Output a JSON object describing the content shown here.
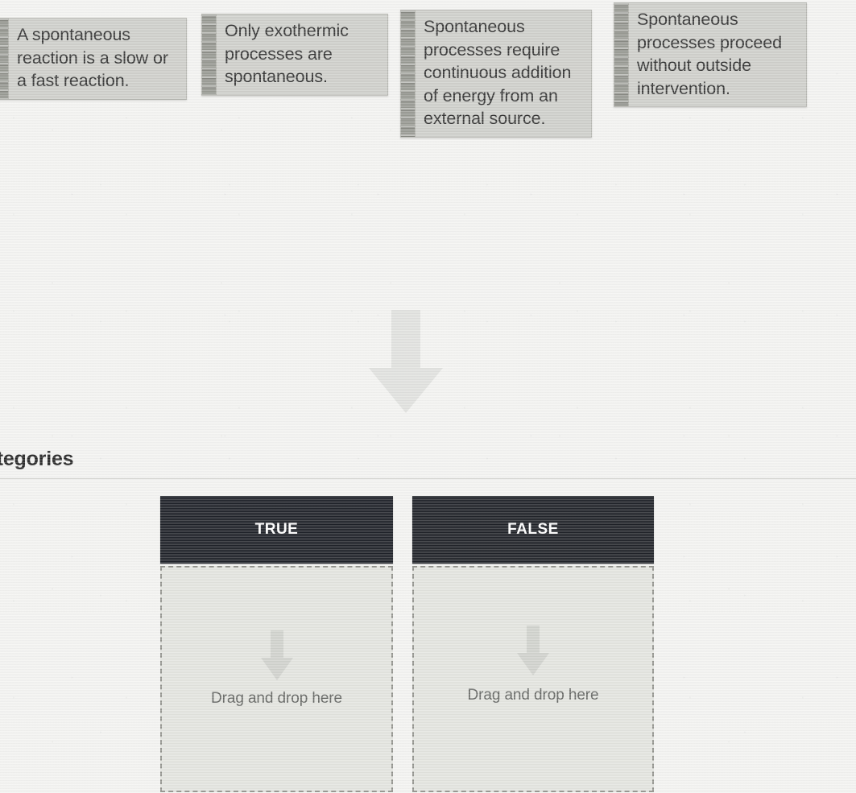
{
  "page": {
    "section_label": "ategories",
    "section_label_full": "Categories"
  },
  "cards": [
    {
      "id": "card-1",
      "text": "A spontaneous reaction is a slow or a fast reaction.",
      "handle": "drag-handle"
    },
    {
      "id": "card-2",
      "text": "Only exothermic processes are spontaneous.",
      "handle": "drag-handle"
    },
    {
      "id": "card-3",
      "text": "Spontaneous processes require continuous addition of energy from an external source.",
      "handle": "drag-handle"
    },
    {
      "id": "card-4",
      "text": "Spontaneous processes proceed without outside intervention.",
      "handle": "drag-handle"
    }
  ],
  "categories": [
    {
      "id": "true",
      "header": "TRUE",
      "dropzone_label": "Drag and drop here",
      "items": []
    },
    {
      "id": "false",
      "header": "FALSE",
      "dropzone_label": "Drag and drop here",
      "items": []
    }
  ],
  "icons": {
    "guide_arrow": "arrow-down-icon",
    "dropzone_arrow": "arrow-down-icon"
  },
  "colors": {
    "page_background": "#f3f3f1",
    "card_background": "#cdcec9",
    "card_handle": "#95968f",
    "header_background": "#17191f",
    "header_text": "#ffffff",
    "dropzone_background": "#e3e4df",
    "dropzone_border": "#8f908a",
    "body_text": "#2b2b2b"
  }
}
